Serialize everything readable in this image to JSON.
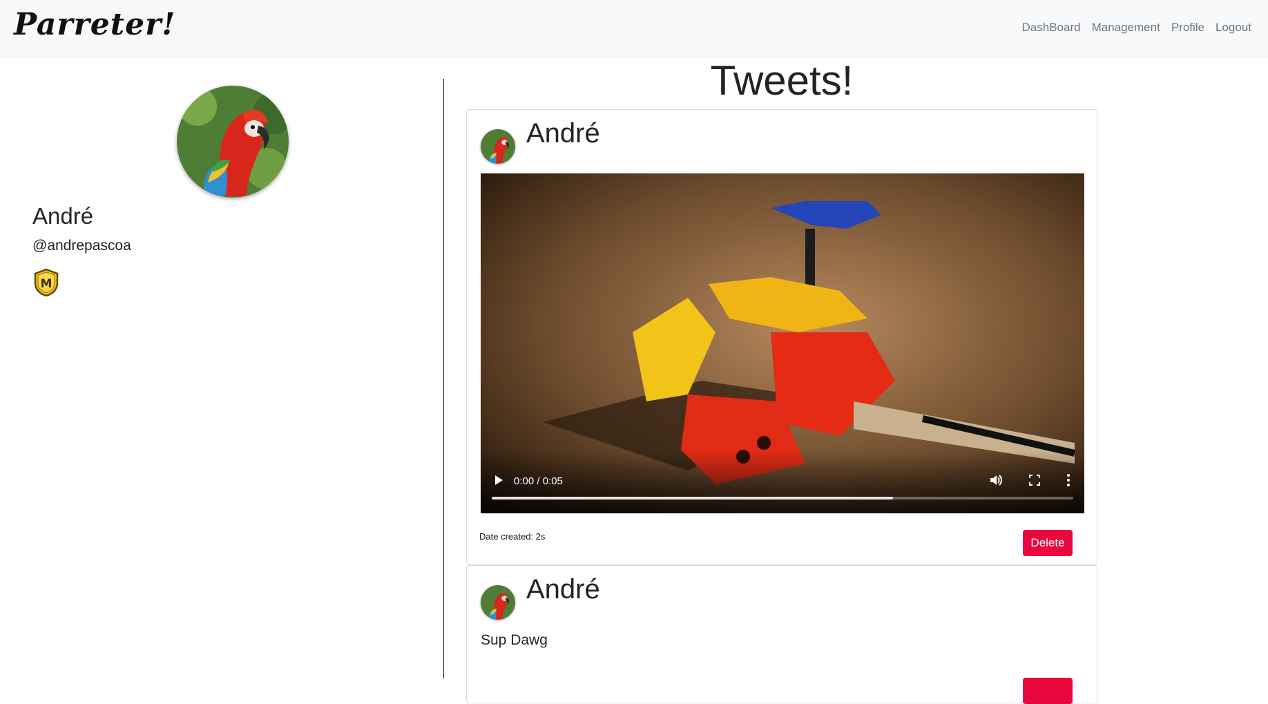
{
  "navbar": {
    "brand": "Parreter!",
    "links": [
      "DashBoard",
      "Management",
      "Profile",
      "Logout"
    ]
  },
  "profile": {
    "name": "André",
    "handle": "@andrepascoa",
    "badge_letter": "M",
    "avatar_icon": "parrot-avatar-icon"
  },
  "tweets": {
    "title": "Tweets!",
    "items": [
      {
        "author": "André",
        "video": {
          "time": "0:00 / 0:05",
          "progress": 0.69
        },
        "date_label": "Date created: 2s",
        "delete_label": "Delete"
      },
      {
        "author": "André",
        "text": "Sup Dawg"
      }
    ]
  },
  "colors": {
    "navbar_bg": "#f8f9fa",
    "delete": "#e8083e",
    "nav_link": "#6c757d"
  }
}
